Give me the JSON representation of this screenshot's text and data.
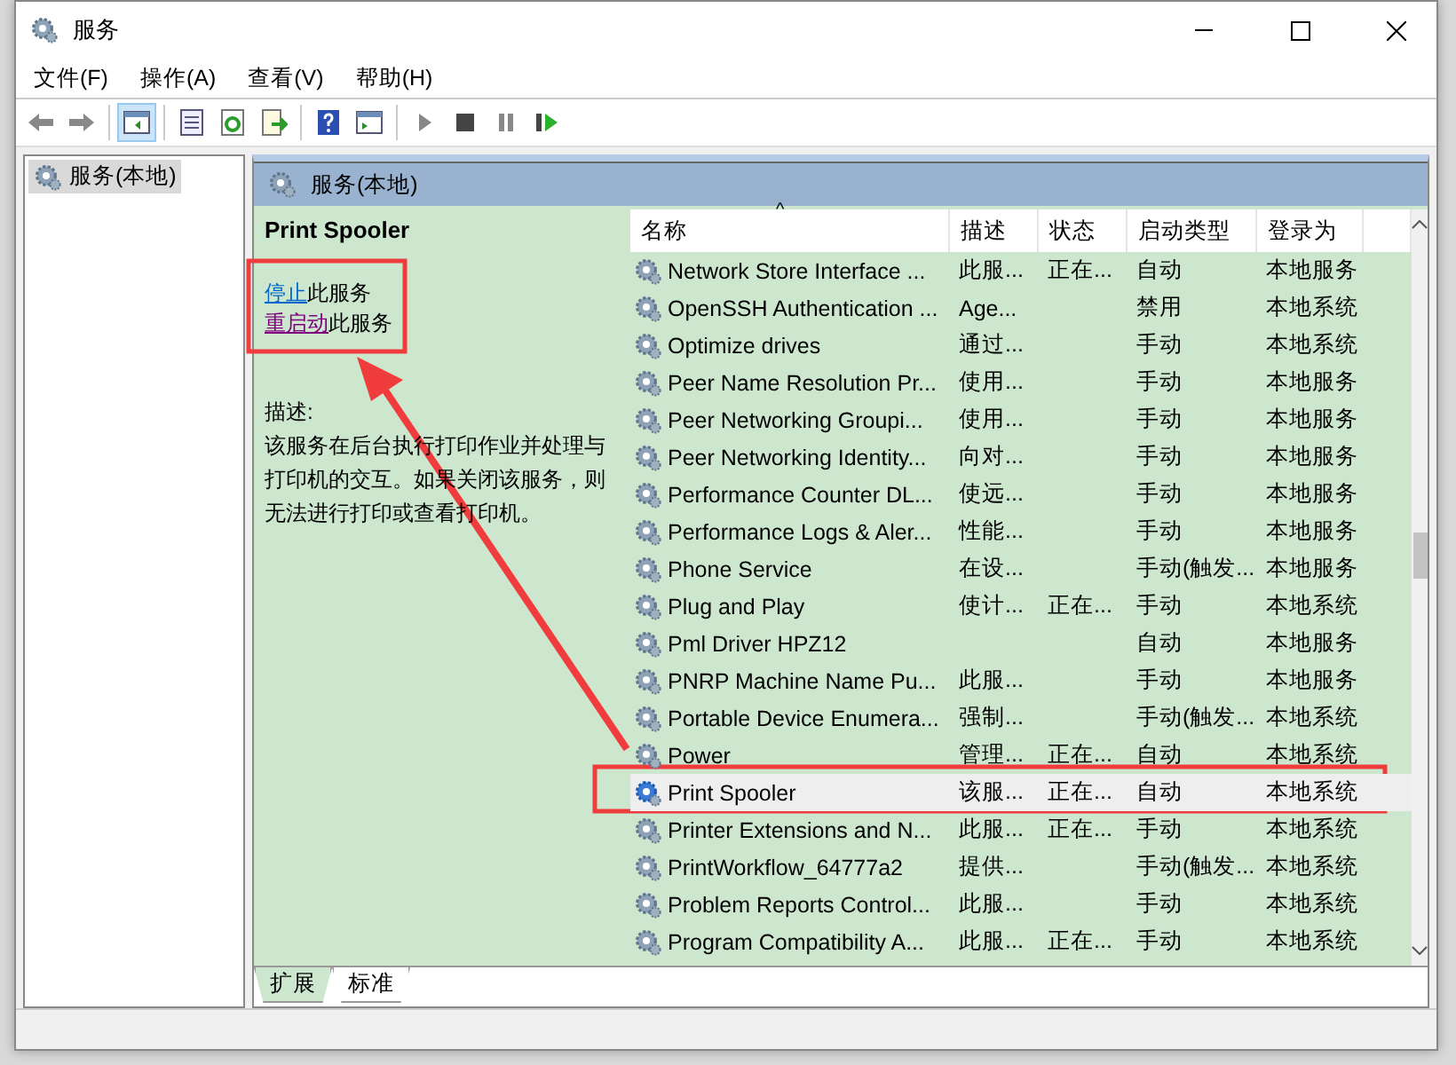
{
  "window": {
    "title": "服务"
  },
  "menu": [
    "文件(F)",
    "操作(A)",
    "查看(V)",
    "帮助(H)"
  ],
  "tree": [
    {
      "label": "服务(本地)",
      "selected": true
    }
  ],
  "header": {
    "title": "服务(本地)"
  },
  "detail": {
    "service_name": "Print Spooler",
    "actions": [
      {
        "link": "停止",
        "rest": "此服务",
        "visited": false
      },
      {
        "link": "重启动",
        "rest": "此服务",
        "visited": true
      }
    ],
    "description_label": "描述:",
    "description": "该服务在后台执行打印作业并处理与打印机的交互。如果关闭该服务，则无法进行打印或查看打印机。"
  },
  "table": {
    "columns": [
      {
        "label": "名称",
        "sort_indicator": "^"
      },
      {
        "label": "描述"
      },
      {
        "label": "状态"
      },
      {
        "label": "启动类型"
      },
      {
        "label": "登录为"
      }
    ],
    "rows": [
      {
        "name": "Network Store Interface ...",
        "description": "此服...",
        "status": "正在...",
        "startup": "自动",
        "logon": "本地服务",
        "selected": false
      },
      {
        "name": "OpenSSH Authentication ...",
        "description": "Age...",
        "status": "",
        "startup": "禁用",
        "logon": "本地系统",
        "selected": false
      },
      {
        "name": "Optimize drives",
        "description": "通过...",
        "status": "",
        "startup": "手动",
        "logon": "本地系统",
        "selected": false
      },
      {
        "name": "Peer Name Resolution Pr...",
        "description": "使用...",
        "status": "",
        "startup": "手动",
        "logon": "本地服务",
        "selected": false
      },
      {
        "name": "Peer Networking Groupi...",
        "description": "使用...",
        "status": "",
        "startup": "手动",
        "logon": "本地服务",
        "selected": false
      },
      {
        "name": "Peer Networking Identity...",
        "description": "向对...",
        "status": "",
        "startup": "手动",
        "logon": "本地服务",
        "selected": false
      },
      {
        "name": "Performance Counter DL...",
        "description": "使远...",
        "status": "",
        "startup": "手动",
        "logon": "本地服务",
        "selected": false
      },
      {
        "name": "Performance Logs & Aler...",
        "description": "性能...",
        "status": "",
        "startup": "手动",
        "logon": "本地服务",
        "selected": false
      },
      {
        "name": "Phone Service",
        "description": "在设...",
        "status": "",
        "startup": "手动(触发...",
        "logon": "本地服务",
        "selected": false
      },
      {
        "name": "Plug and Play",
        "description": "使计...",
        "status": "正在...",
        "startup": "手动",
        "logon": "本地系统",
        "selected": false
      },
      {
        "name": "Pml Driver HPZ12",
        "description": "",
        "status": "",
        "startup": "自动",
        "logon": "本地服务",
        "selected": false
      },
      {
        "name": "PNRP Machine Name Pu...",
        "description": "此服...",
        "status": "",
        "startup": "手动",
        "logon": "本地服务",
        "selected": false
      },
      {
        "name": "Portable Device Enumera...",
        "description": "强制...",
        "status": "",
        "startup": "手动(触发...",
        "logon": "本地系统",
        "selected": false
      },
      {
        "name": "Power",
        "description": "管理...",
        "status": "正在...",
        "startup": "自动",
        "logon": "本地系统",
        "selected": false
      },
      {
        "name": "Print Spooler",
        "description": "该服...",
        "status": "正在...",
        "startup": "自动",
        "logon": "本地系统",
        "selected": true
      },
      {
        "name": "Printer Extensions and N...",
        "description": "此服...",
        "status": "正在...",
        "startup": "手动",
        "logon": "本地系统",
        "selected": false
      },
      {
        "name": "PrintWorkflow_64777a2",
        "description": "提供...",
        "status": "",
        "startup": "手动(触发...",
        "logon": "本地系统",
        "selected": false
      },
      {
        "name": "Problem Reports Control...",
        "description": "此服...",
        "status": "",
        "startup": "手动",
        "logon": "本地系统",
        "selected": false
      },
      {
        "name": "Program Compatibility A...",
        "description": "此服...",
        "status": "正在...",
        "startup": "手动",
        "logon": "本地系统",
        "selected": false
      }
    ]
  },
  "view_tabs": [
    {
      "label": "扩展",
      "selected": true
    },
    {
      "label": "标准",
      "selected": false
    }
  ]
}
